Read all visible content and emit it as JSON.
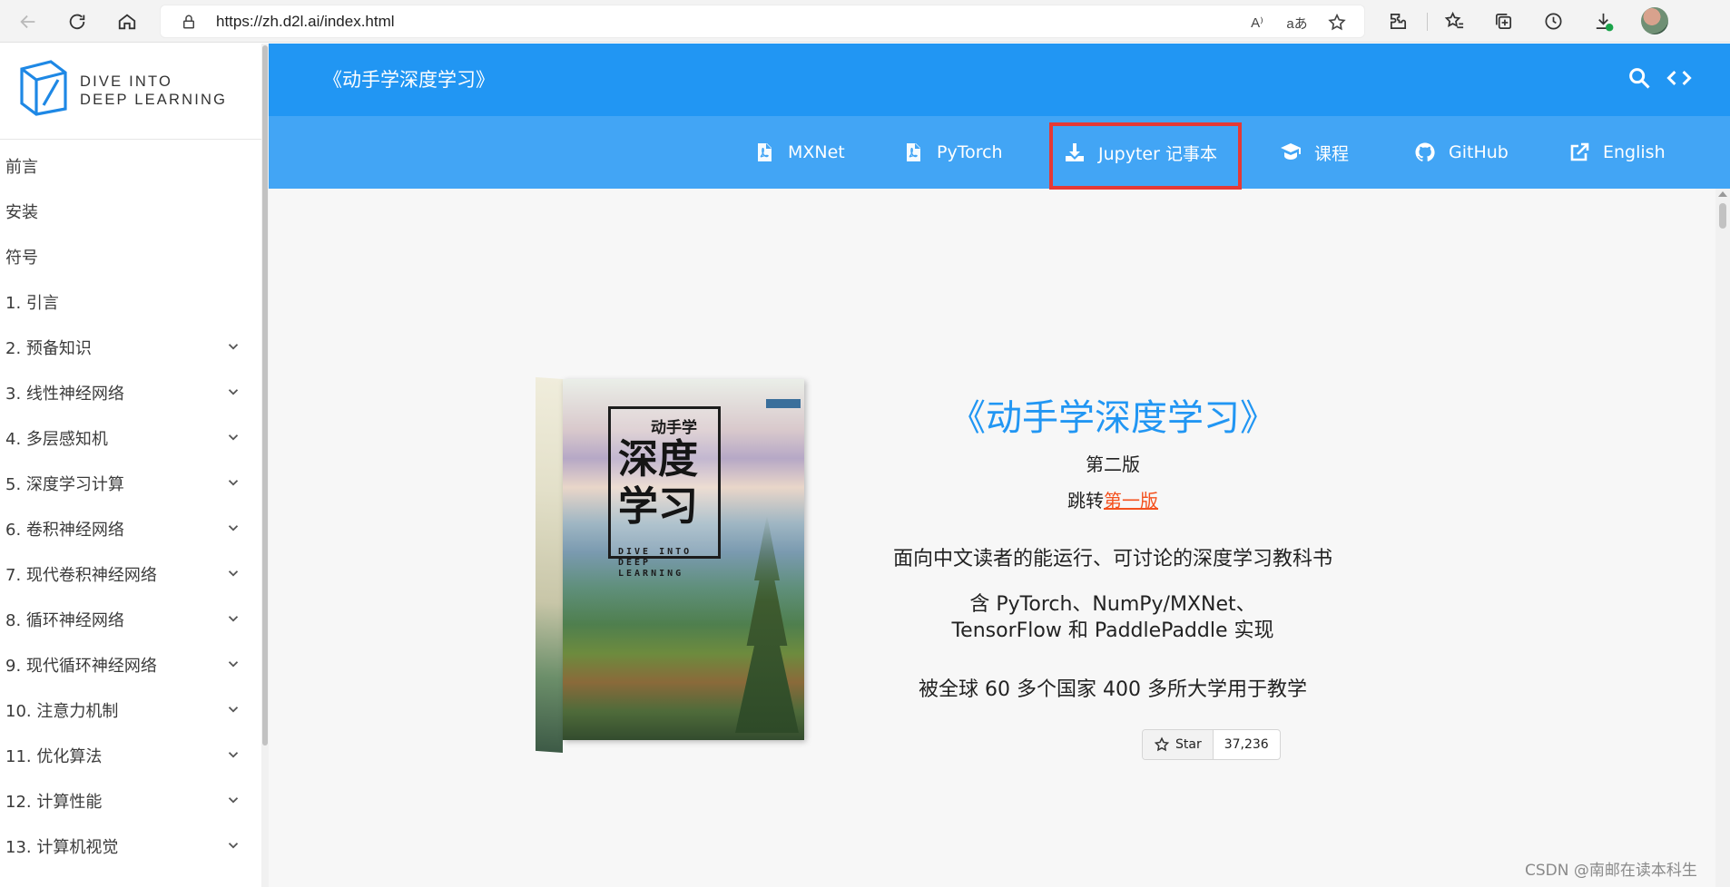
{
  "browser": {
    "url": "https://zh.d2l.ai/index.html",
    "read_aloud_glyph": "A⁾",
    "translate_glyph": "aあ"
  },
  "sidebar": {
    "logo_line1": "DIVE INTO",
    "logo_line2": "DEEP LEARNING",
    "items": [
      {
        "label": "前言",
        "expandable": false
      },
      {
        "label": "安装",
        "expandable": false
      },
      {
        "label": "符号",
        "expandable": false
      },
      {
        "label": "1. 引言",
        "expandable": false
      },
      {
        "label": "2. 预备知识",
        "expandable": true
      },
      {
        "label": "3. 线性神经网络",
        "expandable": true
      },
      {
        "label": "4. 多层感知机",
        "expandable": true
      },
      {
        "label": "5. 深度学习计算",
        "expandable": true
      },
      {
        "label": "6. 卷积神经网络",
        "expandable": true
      },
      {
        "label": "7. 现代卷积神经网络",
        "expandable": true
      },
      {
        "label": "8. 循环神经网络",
        "expandable": true
      },
      {
        "label": "9. 现代循环神经网络",
        "expandable": true
      },
      {
        "label": "10. 注意力机制",
        "expandable": true
      },
      {
        "label": "11. 优化算法",
        "expandable": true
      },
      {
        "label": "12. 计算性能",
        "expandable": true
      },
      {
        "label": "13. 计算机视觉",
        "expandable": true
      }
    ]
  },
  "header": {
    "title": "《动手学深度学习》",
    "nav": [
      {
        "label": "MXNet",
        "icon": "pdf-icon"
      },
      {
        "label": "PyTorch",
        "icon": "pdf-icon"
      },
      {
        "label": "Jupyter 记事本",
        "icon": "download-icon"
      },
      {
        "label": "课程",
        "icon": "teacher-icon"
      },
      {
        "label": "GitHub",
        "icon": "github-icon"
      },
      {
        "label": "English",
        "icon": "external-link-icon"
      }
    ],
    "highlighted_nav": "Jupyter 记事本",
    "highlight_color": "#e53935"
  },
  "book": {
    "brand": "动手学",
    "title_big": "深度学习",
    "title_en": "DIVE INTO DEEP LEARNING"
  },
  "hero": {
    "title": "《动手学深度学习》",
    "edition": "第二版",
    "jump_prefix": "跳转",
    "jump_link": "第一版",
    "line1": "面向中文读者的能运行、可讨论的深度学习教科书",
    "line2": "含 PyTorch、NumPy/MXNet、TensorFlow 和 PaddlePaddle 实现",
    "line3": "被全球 60 多个国家 400 多所大学用于教学"
  },
  "github_star": {
    "label": "Star",
    "count": "37,236"
  },
  "watermark": "CSDN @南邮在读本科生",
  "colors": {
    "header_top": "#2196f3",
    "header_nav": "#42a5f5",
    "hero_title": "#2196f3",
    "link": "#f4511e"
  }
}
